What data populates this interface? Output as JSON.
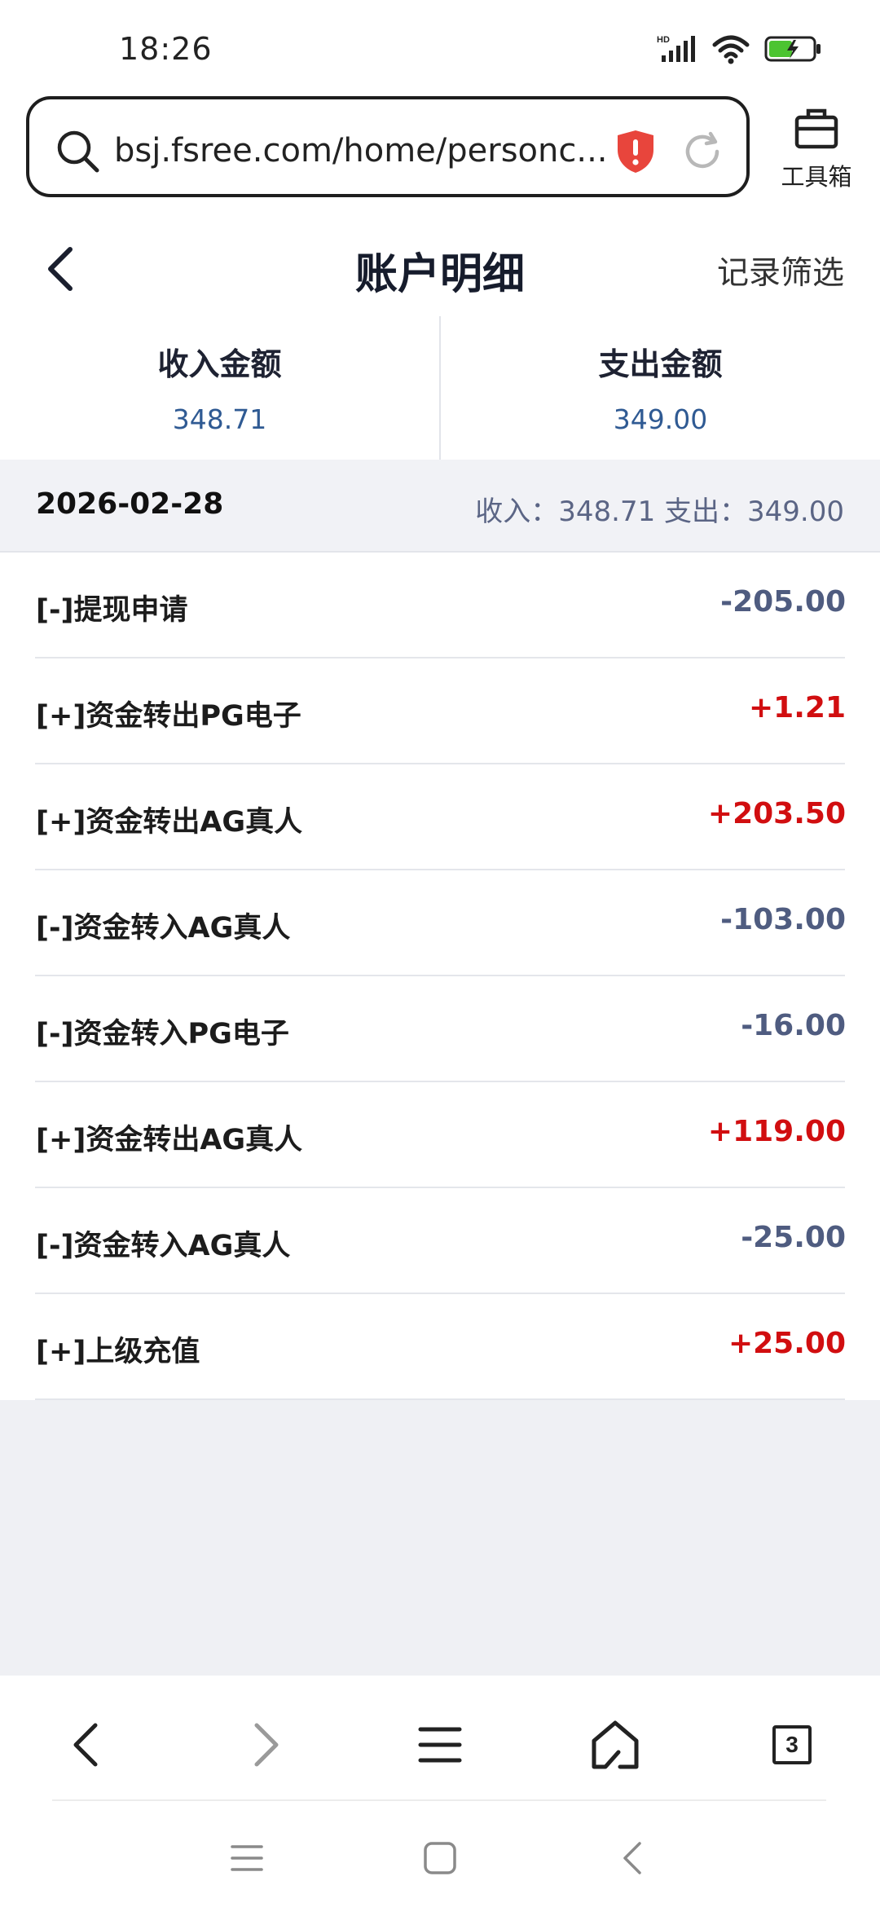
{
  "status_bar": {
    "time": "18:26",
    "network": "HD",
    "icons": [
      "hd-signal-icon",
      "wifi-icon",
      "battery-charging-icon"
    ]
  },
  "browser": {
    "url": "bsj.fsree.com/home/personc...",
    "toolbox_label": "工具箱",
    "open_tabs": "3"
  },
  "header": {
    "title": "账户明细",
    "filter_label": "记录筛选"
  },
  "summary": {
    "income_label": "收入金额",
    "income_value": "348.71",
    "expense_label": "支出金额",
    "expense_value": "349.00"
  },
  "group": {
    "date": "2026-02-28",
    "totals": "收入：348.71   支出：349.00"
  },
  "transactions": [
    {
      "name": "[-]提现申请",
      "amount": "-205.00",
      "sign": "negative"
    },
    {
      "name": "[+]资金转出PG电子",
      "amount": "+1.21",
      "sign": "positive"
    },
    {
      "name": "[+]资金转出AG真人",
      "amount": "+203.50",
      "sign": "positive"
    },
    {
      "name": "[-]资金转入AG真人",
      "amount": "-103.00",
      "sign": "negative"
    },
    {
      "name": "[-]资金转入PG电子",
      "amount": "-16.00",
      "sign": "negative"
    },
    {
      "name": "[+]资金转出AG真人",
      "amount": "+119.00",
      "sign": "positive"
    },
    {
      "name": "[-]资金转入AG真人",
      "amount": "-25.00",
      "sign": "negative"
    },
    {
      "name": "[+]上级充值",
      "amount": "+25.00",
      "sign": "positive"
    }
  ],
  "colors": {
    "positive": "#d10e10",
    "negative": "#4f5c80",
    "summary_value": "#2f5a93",
    "shield": "#e8453c"
  }
}
